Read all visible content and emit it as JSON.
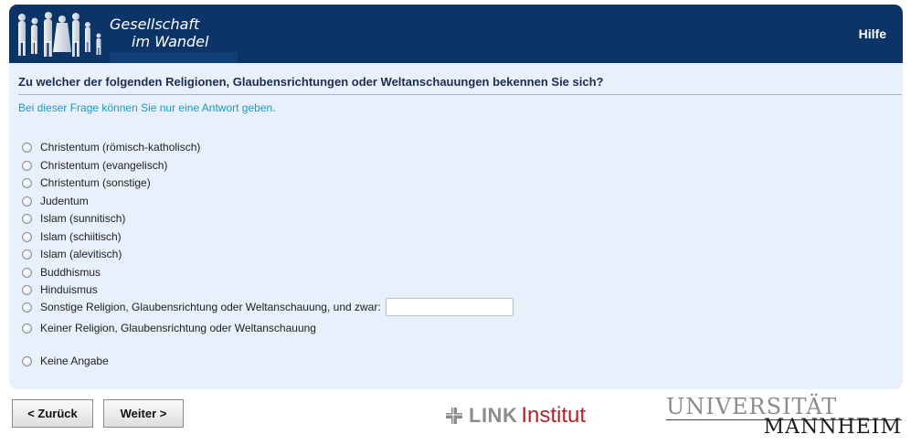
{
  "header": {
    "logo_line1": "Gesellschaft",
    "logo_line2": "im Wandel",
    "help_label": "Hilfe",
    "bg_color": "#0c3467"
  },
  "question": {
    "text": "Zu welcher der folgenden Religionen, Glaubensrichtungen oder Weltanschauungen bekennen Sie sich?",
    "instruction": "Bei dieser Frage können Sie nur eine Antwort geben."
  },
  "options": [
    "Christentum (römisch-katholisch)",
    "Christentum (evangelisch)",
    "Christentum (sonstige)",
    "Judentum",
    "Islam (sunnitisch)",
    "Islam (schiitisch)",
    "Islam (alevitisch)",
    "Buddhismus",
    "Hinduismus",
    "Sonstige Religion, Glaubensrichtung oder Weltanschauung, und zwar:",
    "Keiner Religion, Glaubensrichtung oder Weltanschauung",
    "Keine Angabe"
  ],
  "other_input": {
    "value": ""
  },
  "nav": {
    "back_label": "< Zurück",
    "next_label": "Weiter >"
  },
  "footer": {
    "link_word": "LINK",
    "link_institut": "Institut",
    "uni_line1": "UNIVERSITÄT",
    "uni_line2": "MANNHEIM"
  }
}
